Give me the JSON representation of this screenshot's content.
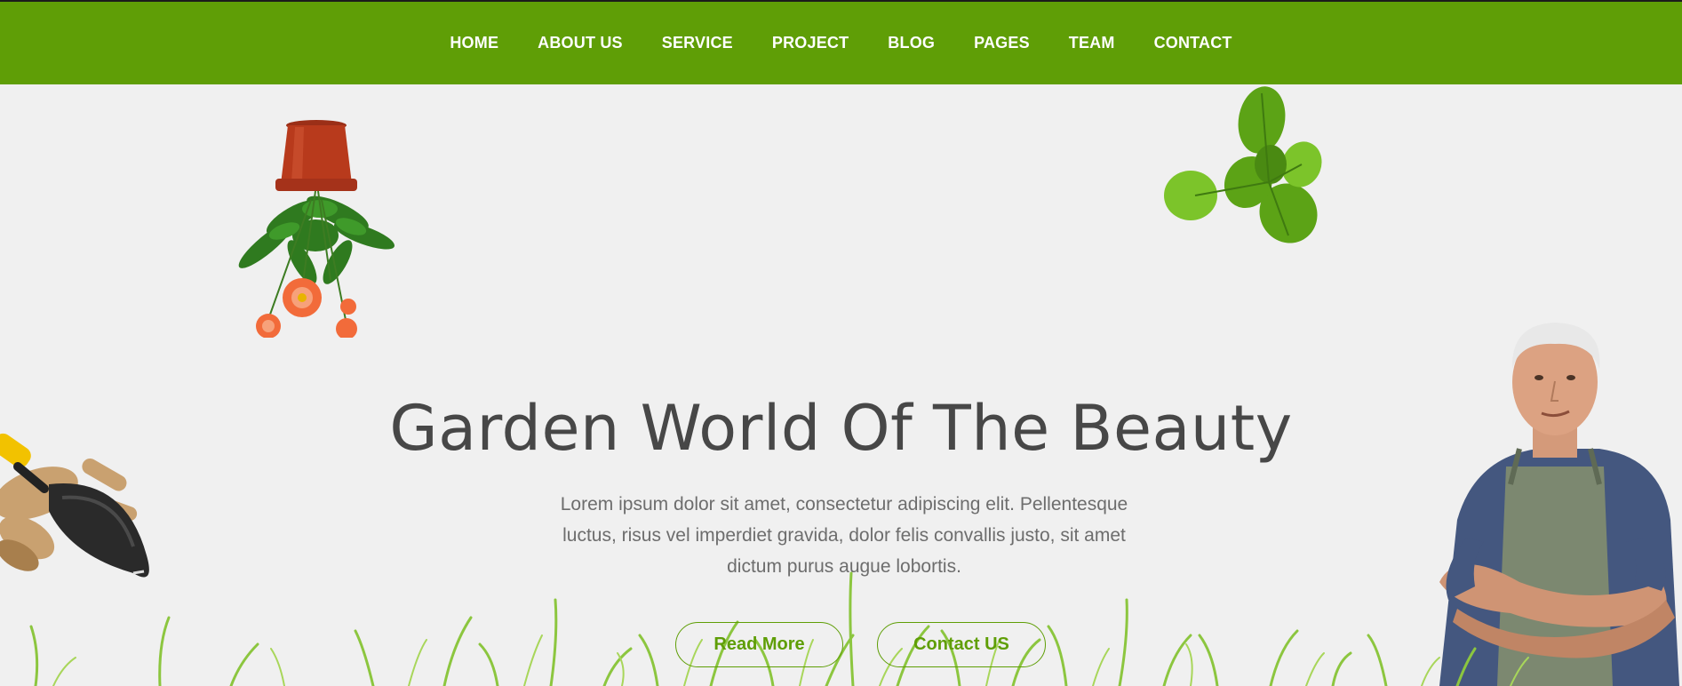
{
  "nav": {
    "items": [
      {
        "label": "HOME"
      },
      {
        "label": "ABOUT US"
      },
      {
        "label": "SERVICE"
      },
      {
        "label": "PROJECT"
      },
      {
        "label": "BLOG"
      },
      {
        "label": "PAGES"
      },
      {
        "label": "TEAM"
      },
      {
        "label": "CONTACT"
      }
    ]
  },
  "hero": {
    "title": "Garden World Of The Beauty",
    "description": "Lorem ipsum dolor sit amet, consectetur adipiscing elit. Pellentesque luctus, risus vel imperdiet gravida, dolor felis convallis justo, sit amet dictum purus augue lobortis.",
    "read_more_label": "Read More",
    "contact_label": "Contact US"
  },
  "colors": {
    "brand_green": "#5f9e06",
    "background": "#f0f0f0",
    "headline": "#474747",
    "body_text": "#6d6d6d"
  },
  "icons": [
    "flower-pot-illustration",
    "leaves-illustration",
    "garden-trowel-illustration",
    "gardener-photo",
    "grass-illustration"
  ]
}
